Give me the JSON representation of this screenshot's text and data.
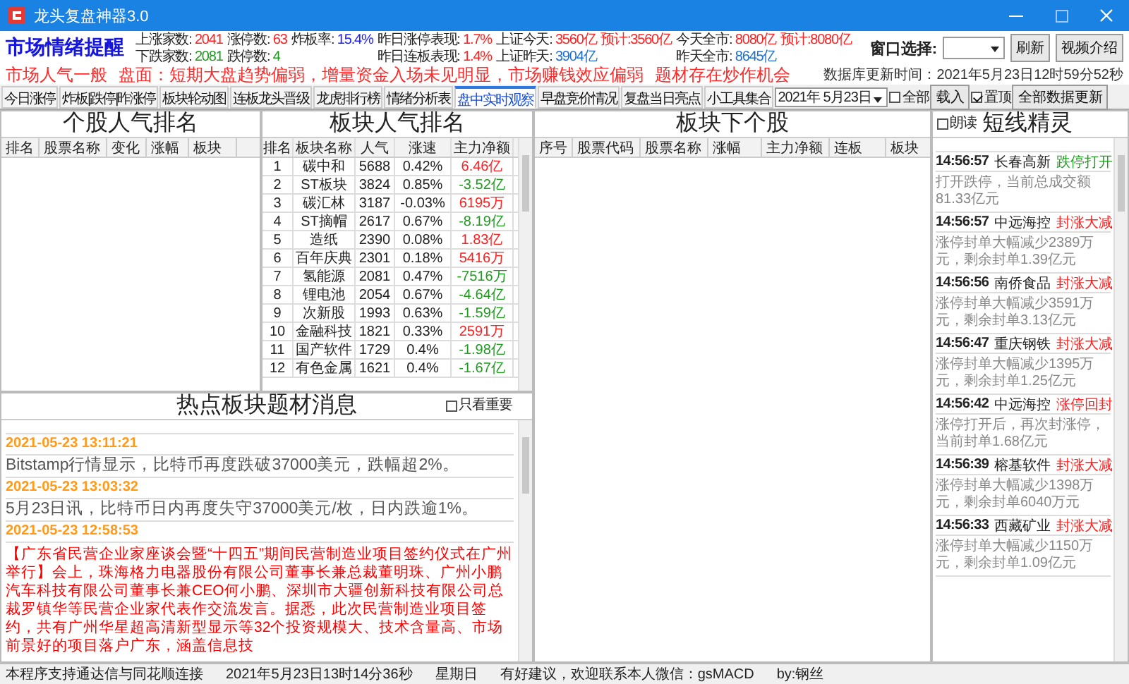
{
  "window": {
    "title": "龙头复盘神器3.0"
  },
  "header": {
    "title": "市场情绪提醒",
    "stat_columns": [
      [
        {
          "kind": "stat",
          "label": "上涨家数:",
          "value": "2041",
          "color": "#ff2020"
        },
        {
          "kind": "stat",
          "label": "下跌家数:",
          "value": "2081",
          "color": "#1f9a1f"
        }
      ],
      [
        {
          "kind": "stat",
          "label": "涨停数:",
          "value": "63",
          "color": "#ff2020"
        },
        {
          "kind": "stat",
          "label": "跌停数:",
          "value": "4",
          "color": "#1f9a1f"
        }
      ],
      [
        {
          "kind": "stat",
          "label": "炸板率:",
          "value": "15.4%",
          "color": "#2020ff"
        }
      ],
      [
        {
          "kind": "stat",
          "label": "昨日涨停表现:",
          "value": "1.7%",
          "color": "#ff2020"
        },
        {
          "kind": "stat",
          "label": "昨日连板表现:",
          "value": "1.4%",
          "color": "#ff2020"
        }
      ],
      [
        {
          "kind": "stat",
          "label": "上证今天:",
          "value": "3560亿",
          "color": "#ff2020"
        },
        {
          "kind": "stat",
          "label": "上证昨天:",
          "value": "3904亿",
          "color": "#1e6fd0"
        }
      ],
      [
        {
          "kind": "estimate",
          "label": "预计:",
          "value": "3560亿",
          "color": "#ff2020"
        }
      ],
      [
        {
          "kind": "stat",
          "label": "今天全市:",
          "value": "8080亿",
          "color": "#ff2020"
        },
        {
          "kind": "stat",
          "label": "昨天全市:",
          "value": "8645亿",
          "color": "#1e6fd0"
        }
      ],
      [
        {
          "kind": "estimate",
          "label": "预计:",
          "value": "8080亿",
          "color": "#ff2020"
        }
      ]
    ],
    "window_select": {
      "label": "窗口选择:"
    },
    "buttons": [
      "刷新",
      "视频介绍"
    ],
    "mood": "市场人气一般",
    "comment": "盘面：短期大盘趋势偏弱，增量资金入场未见明显，市场赚钱效应偏弱",
    "theme": "题材存在炒作机会",
    "db_update": "数据库更新时间：2021年5月23日12时59分52秒"
  },
  "tabs": [
    {
      "label": "今日涨停",
      "selected": false
    },
    {
      "label": "炸板|跌停|昨涨停",
      "selected": false
    },
    {
      "label": "板块轮动图",
      "selected": false
    },
    {
      "label": "连板龙头晋级",
      "selected": false
    },
    {
      "label": "龙虎排行榜",
      "selected": false
    },
    {
      "label": "情绪分析表",
      "selected": false
    },
    {
      "label": "盘中实时观察",
      "selected": true
    },
    {
      "label": "早盘竞价情况",
      "selected": false
    },
    {
      "label": "复盘当日亮点",
      "selected": false
    },
    {
      "label": "小工具集合",
      "selected": false
    }
  ],
  "toolbar": {
    "date": "2021年 5月23日",
    "all": {
      "label": "全部",
      "checked": false
    },
    "load_button": "载入",
    "pin": {
      "label": "置顶",
      "checked": true
    },
    "update_button": "全部数据更新"
  },
  "stock_ranking": {
    "title": "个股人气排名",
    "columns": [
      "排名",
      "股票名称",
      "变化",
      "涨幅",
      "板块"
    ]
  },
  "sector_ranking": {
    "title": "板块人气排名",
    "columns": [
      "排名",
      "板块名称",
      "人气",
      "涨速",
      "主力净额"
    ],
    "rows": [
      {
        "rank": "1",
        "name": "碳中和",
        "heat": "5688",
        "speed": "0.42%",
        "net": "6.46亿",
        "color": "#ff2020"
      },
      {
        "rank": "2",
        "name": "ST板块",
        "heat": "3824",
        "speed": "0.85%",
        "net": "-3.52亿",
        "color": "#1f9a1f"
      },
      {
        "rank": "3",
        "name": "碳汇林",
        "heat": "3187",
        "speed": "-0.03%",
        "net": "6195万",
        "color": "#ff2020"
      },
      {
        "rank": "4",
        "name": "ST摘帽",
        "heat": "2617",
        "speed": "0.67%",
        "net": "-8.19亿",
        "color": "#1f9a1f"
      },
      {
        "rank": "5",
        "name": "造纸",
        "heat": "2390",
        "speed": "0.08%",
        "net": "1.83亿",
        "color": "#ff2020"
      },
      {
        "rank": "6",
        "name": "百年庆典",
        "heat": "2301",
        "speed": "0.18%",
        "net": "5416万",
        "color": "#ff2020"
      },
      {
        "rank": "7",
        "name": "氢能源",
        "heat": "2081",
        "speed": "0.47%",
        "net": "-7516万",
        "color": "#1f9a1f"
      },
      {
        "rank": "8",
        "name": "锂电池",
        "heat": "2054",
        "speed": "0.67%",
        "net": "-4.64亿",
        "color": "#1f9a1f"
      },
      {
        "rank": "9",
        "name": "次新股",
        "heat": "1993",
        "speed": "0.63%",
        "net": "-1.59亿",
        "color": "#1f9a1f"
      },
      {
        "rank": "10",
        "name": "金融科技",
        "heat": "1821",
        "speed": "0.33%",
        "net": "2591万",
        "color": "#ff2020"
      },
      {
        "rank": "11",
        "name": "国产软件",
        "heat": "1729",
        "speed": "0.4%",
        "net": "-1.98亿",
        "color": "#1f9a1f"
      },
      {
        "rank": "12",
        "name": "有色金属",
        "heat": "1621",
        "speed": "0.4%",
        "net": "-1.67亿",
        "color": "#1f9a1f"
      }
    ]
  },
  "sector_stocks": {
    "title": "板块下个股",
    "columns": [
      "序号",
      "股票代码",
      "股票名称",
      "涨幅",
      "主力净额",
      "连板",
      "板块"
    ]
  },
  "news": {
    "title": "热点板块题材消息",
    "important_only": {
      "label": "只看重要",
      "checked": false
    },
    "items": [
      {
        "time": "2021-05-23 13:11:21",
        "text": "Bitstamp行情显示，比特币再度跌破37000美元，跌幅超2%。",
        "color": "#555555"
      },
      {
        "time": "2021-05-23 13:03:32",
        "text": "5月23日讯，比特币日内再度失守37000美元/枚，日内跌逾1%。",
        "color": "#555555"
      },
      {
        "time": "2021-05-23 12:58:53",
        "text": "【广东省民营企业家座谈会暨“十四五”期间民营制造业项目签约仪式在广州举行】会上，珠海格力电器股份有限公司董事长兼总裁董明珠、广州小鹏汽车科技有限公司董事长兼CEO何小鹏、深圳市大疆创新科技有限公司总裁罗镇华等民营企业家代表作交流发言。据悉，此次民营制造业项目签约，共有广州华星超高清新型显示等32个投资规模大、技术含量高、市场前景好的项目落户广东，涵盖信息技",
        "color": "#ff0000"
      }
    ]
  },
  "sprite": {
    "title": "短线精灵",
    "read_aloud": {
      "label": "朗读",
      "checked": false
    },
    "items": [
      {
        "time": "14:56:57",
        "name": "长春高新",
        "event": "跌停打开",
        "color": "#1f9a1f",
        "detail": "打开跌停，当前总成交额81.33亿元"
      },
      {
        "time": "14:56:57",
        "name": "中远海控",
        "event": "封涨大减",
        "color": "#ff2020",
        "detail": "涨停封单大幅减少2389万元，剩余封单1.39亿元"
      },
      {
        "time": "14:56:56",
        "name": "南侨食品",
        "event": "封涨大减",
        "color": "#ff2020",
        "detail": "涨停封单大幅减少3591万元，剩余封单3.13亿元"
      },
      {
        "time": "14:56:47",
        "name": "重庆钢铁",
        "event": "封涨大减",
        "color": "#ff2020",
        "detail": "涨停封单大幅减少1395万元，剩余封单1.25亿元"
      },
      {
        "time": "14:56:42",
        "name": "中远海控",
        "event": "涨停回封",
        "color": "#ff2020",
        "detail": "涨停打开后，再次封涨停，当前封单1.68亿元"
      },
      {
        "time": "14:56:39",
        "name": "榕基软件",
        "event": "封涨大减",
        "color": "#ff2020",
        "detail": "涨停封单大幅减少1398万元，剩余封单6040万元"
      },
      {
        "time": "14:56:33",
        "name": "西藏矿业",
        "event": "封涨大减",
        "color": "#ff2020",
        "detail": "涨停封单大幅减少1150万元，剩余封单1.09亿元"
      }
    ]
  },
  "status_bar": [
    "本程序支持通达信与同花顺连接",
    "2021年5月23日13时14分36秒",
    "星期日",
    "有好建议，欢迎联系本人微信：gsMACD",
    "by:钢丝"
  ]
}
